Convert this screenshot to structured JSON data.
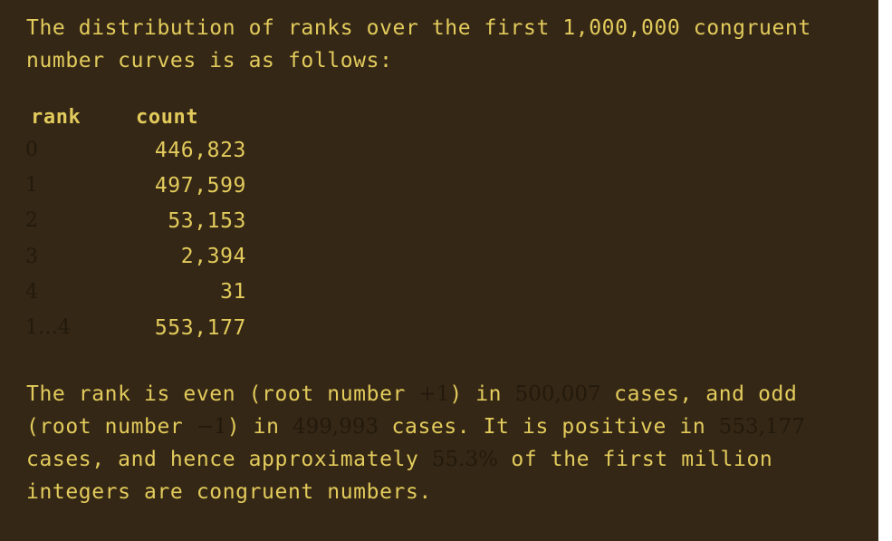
{
  "intro": "The distribution of ranks over the first 1,000,000 congruent number curves is as follows:",
  "table": {
    "headers": {
      "rank": "rank",
      "count": "count"
    },
    "rows": [
      {
        "rank": "0",
        "count": "446,823"
      },
      {
        "rank": "1",
        "count": "497,599"
      },
      {
        "rank": "2",
        "count": "53,153"
      },
      {
        "rank": "3",
        "count": "2,394"
      },
      {
        "rank": "4",
        "count": "31"
      },
      {
        "rank": "1…4",
        "count": "553,177"
      }
    ]
  },
  "outro": {
    "p1": "The rank is even (root number ",
    "m1": "+1",
    "p2": ") in ",
    "m2": "500,007",
    "p3": " cases, and odd (root number ",
    "m3": "−1",
    "p4": ") in ",
    "m4": "499,993",
    "p5": " cases. It is positive in ",
    "m5": "553,177",
    "p6": " cases, and hence approximately ",
    "m6": "55.3%",
    "p7": " of the first million integers are congruent numbers."
  },
  "colors": {
    "background": "#352715",
    "text": "#e2cb5c",
    "math": "#221a0d"
  }
}
